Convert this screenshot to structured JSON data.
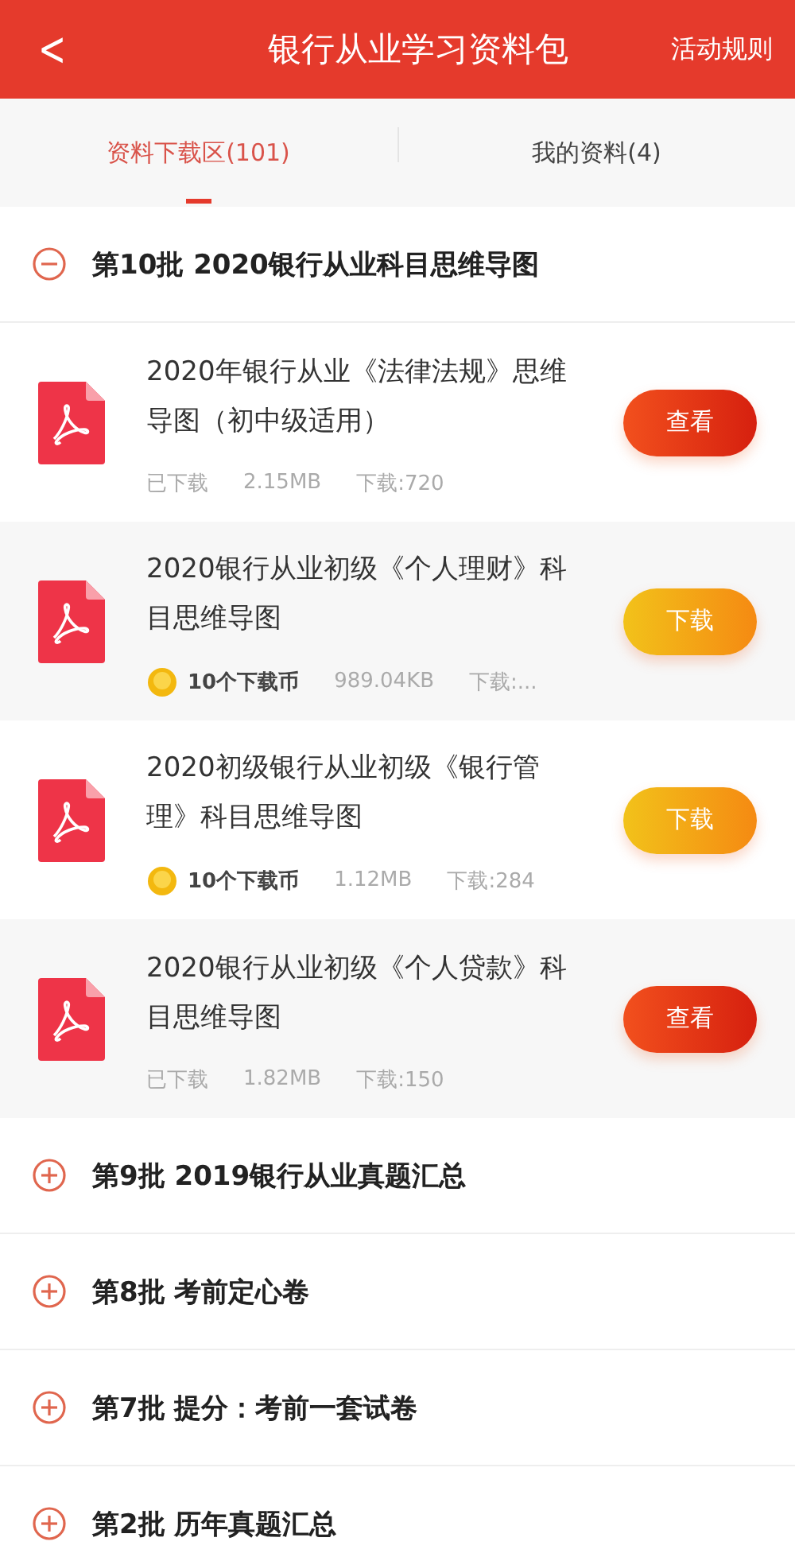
{
  "header": {
    "back": "<",
    "title": "银行从业学习资料包",
    "action": "活动规则"
  },
  "tabs": [
    {
      "label": "资料下载区(101)",
      "selected": true
    },
    {
      "label": "我的资料(4)",
      "selected": false
    }
  ],
  "groups": [
    {
      "title": "第10批 2020银行从业科目思维导图",
      "expanded": true,
      "items": [
        {
          "title": "2020年银行从业《法律法规》思维导图（初中级适用）",
          "kind": "downloaded",
          "status": "已下载",
          "size": "2.15MB",
          "downloads": "下载:720",
          "button": "查看"
        },
        {
          "title": "2020银行从业初级《个人理财》科目思维导图",
          "kind": "paid",
          "status": "10个下载币",
          "size": "989.04KB",
          "downloads": "下载:...",
          "button": "下载"
        },
        {
          "title": "2020初级银行从业初级《银行管理》科目思维导图",
          "kind": "paid",
          "status": "10个下载币",
          "size": "1.12MB",
          "downloads": "下载:284",
          "button": "下载"
        },
        {
          "title": "2020银行从业初级《个人贷款》科目思维导图",
          "kind": "downloaded",
          "status": "已下载",
          "size": "1.82MB",
          "downloads": "下载:150",
          "button": "查看"
        }
      ]
    },
    {
      "title": "第9批 2019银行从业真题汇总",
      "expanded": false
    },
    {
      "title": "第8批 考前定心卷",
      "expanded": false
    },
    {
      "title": "第7批 提分：考前一套试卷",
      "expanded": false
    },
    {
      "title": "第2批 历年真题汇总",
      "expanded": false
    }
  ]
}
